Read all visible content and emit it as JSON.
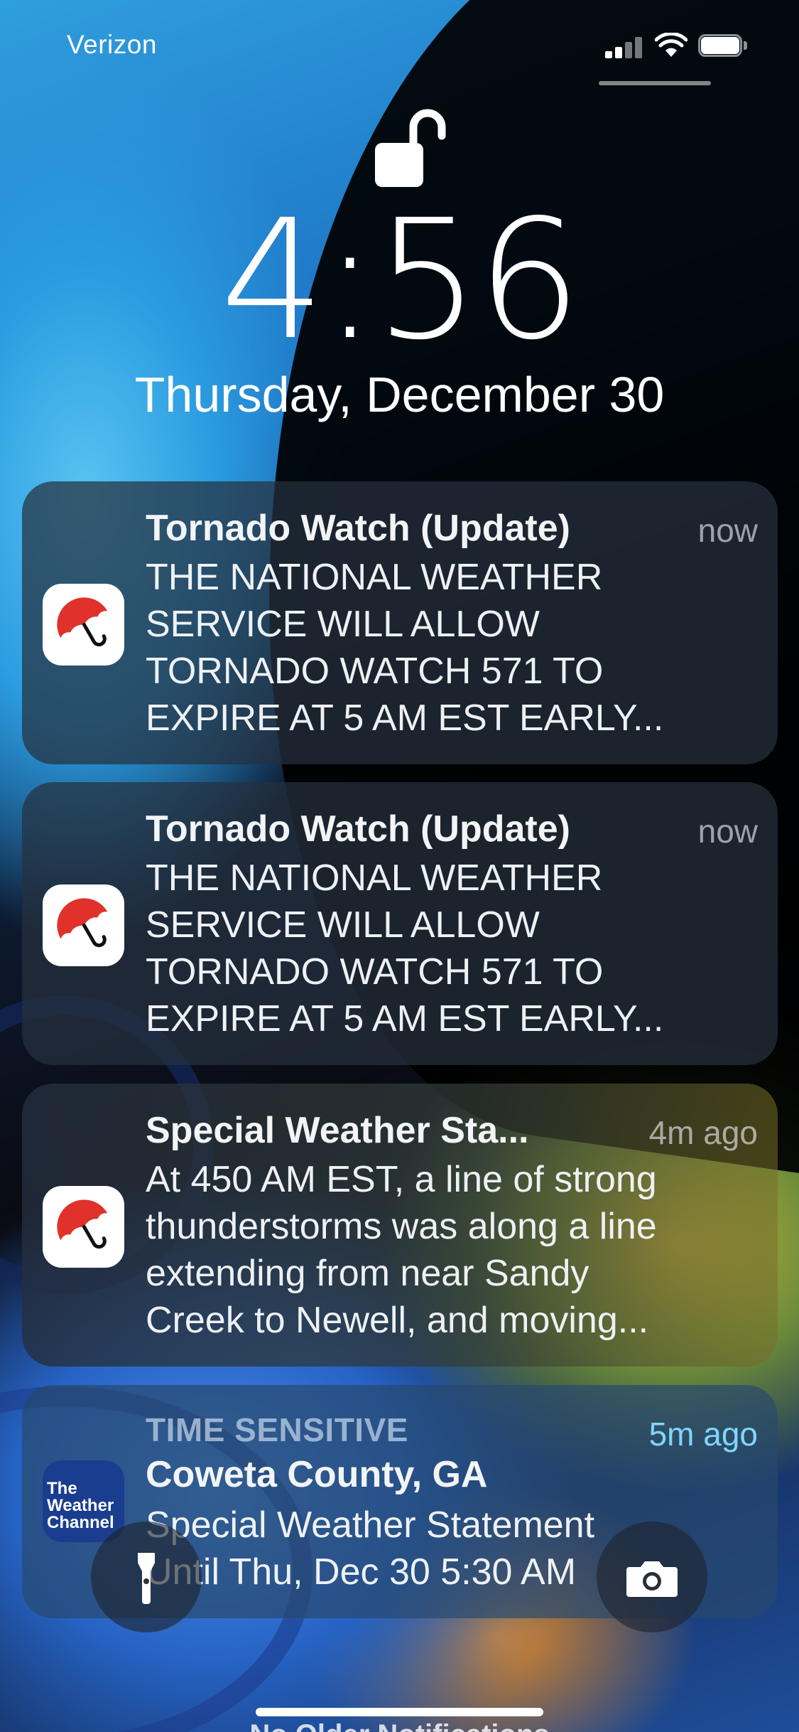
{
  "status_bar": {
    "carrier": "Verizon",
    "signal_bars": 2,
    "icons": [
      "signal-icon",
      "wifi-icon",
      "battery-icon"
    ]
  },
  "lock_screen": {
    "time": "4:56",
    "date": "Thursday, December 30",
    "lock_icon": "unlocked-padlock-icon"
  },
  "notifications": [
    {
      "app_icon": "umbrella-icon",
      "title": "Tornado Watch (Update)",
      "time_ago": "now",
      "body_lines": [
        "THE NATIONAL WEATHER",
        "SERVICE WILL ALLOW",
        "TORNADO WATCH 571 TO",
        "EXPIRE AT 5 AM EST EARLY..."
      ]
    },
    {
      "app_icon": "umbrella-icon",
      "title": "Tornado Watch (Update)",
      "time_ago": "now",
      "body_lines": [
        "THE NATIONAL WEATHER",
        "SERVICE WILL ALLOW",
        "TORNADO WATCH 571 TO",
        "EXPIRE AT 5 AM EST EARLY..."
      ]
    },
    {
      "app_icon": "umbrella-icon",
      "title": "Special Weather Sta...",
      "time_ago": "4m ago",
      "body_lines": [
        "At 450 AM EST, a line of strong",
        "thunderstorms was along a line",
        "extending from near Sandy",
        "Creek to Newell, and moving..."
      ]
    },
    {
      "app_icon": "weather-channel-logo",
      "app_icon_text": [
        "The",
        "Weather",
        "Channel"
      ],
      "eyebrow": "TIME SENSITIVE",
      "title": "Coweta County, GA",
      "time_ago": "5m ago",
      "body_lines": [
        "Special Weather Statement",
        "Until Thu, Dec 30 5:30 AM"
      ]
    }
  ],
  "quick_actions": {
    "left": "flashlight-icon",
    "right": "camera-icon"
  },
  "footer_peek": "No Older Notifications",
  "colors": {
    "umbrella_red": "#e0312b",
    "time_sensitive_blue": "#7fd6ff",
    "twc_blue": "#1a3d8f"
  }
}
